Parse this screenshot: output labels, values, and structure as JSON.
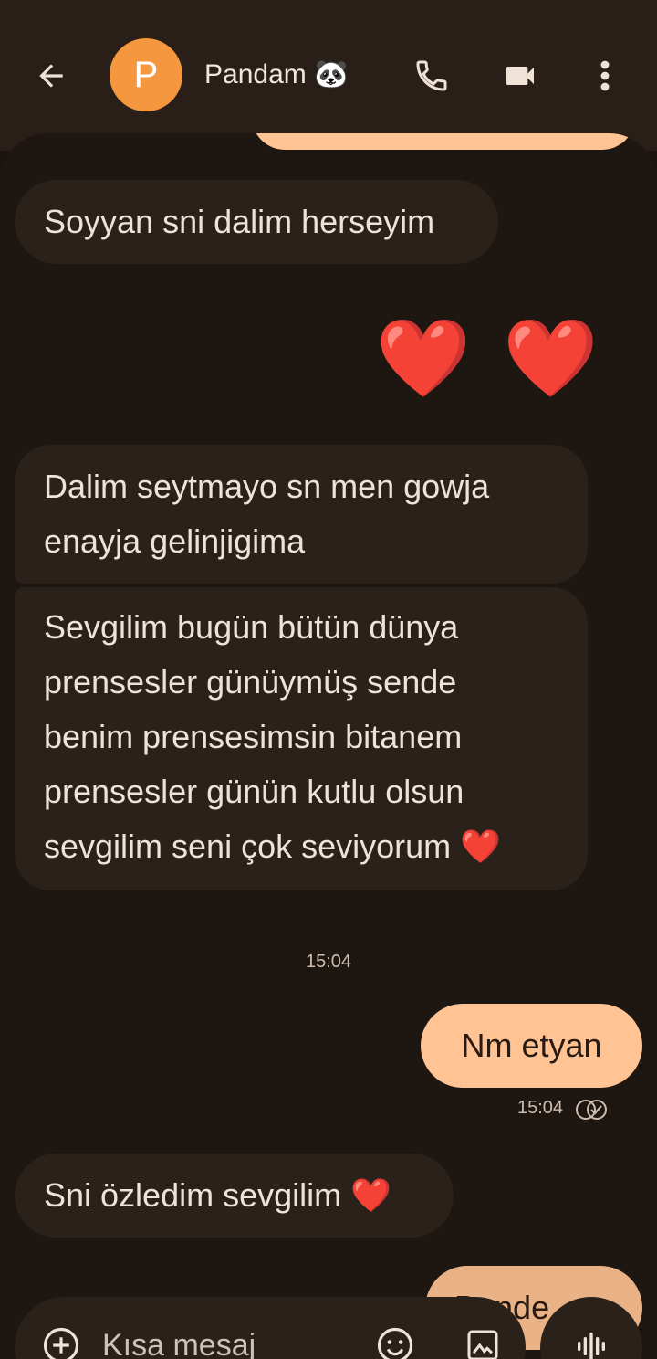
{
  "header": {
    "avatar_letter": "P",
    "contact_name": "Pandam 🐼"
  },
  "messages": {
    "m1": "Soyyan sni dalim herseyim",
    "m2_emoji": "❤️ ❤️",
    "m3": "Dalim seytmayo sn men gowja enayja gelinjigima",
    "m4_lines": [
      "Sevgilim bugün bütün dünya",
      "prensesler günüymüş sende",
      "benim prensesimsin bitanem",
      "prensesler günün kutlu olsun",
      "sevgilim seni çok seviyorum"
    ],
    "m4_heart": "❤️",
    "time_divider": "15:04",
    "m5": "Nm etyan",
    "m5_time": "15:04",
    "m6": "Sni özledim sevgilim",
    "m6_heart": "❤️",
    "m7_partial": "Bende"
  },
  "composer": {
    "placeholder": "Kısa mesaj"
  },
  "colors": {
    "accent": "#ffc394",
    "avatar": "#f5973f",
    "heart": "#e21b2d"
  },
  "icons": [
    "back-arrow-icon",
    "phone-icon",
    "video-camera-icon",
    "more-vert-icon",
    "add-circle-icon",
    "emoji-icon",
    "image-icon",
    "voice-icon",
    "delivered-check-icon"
  ]
}
